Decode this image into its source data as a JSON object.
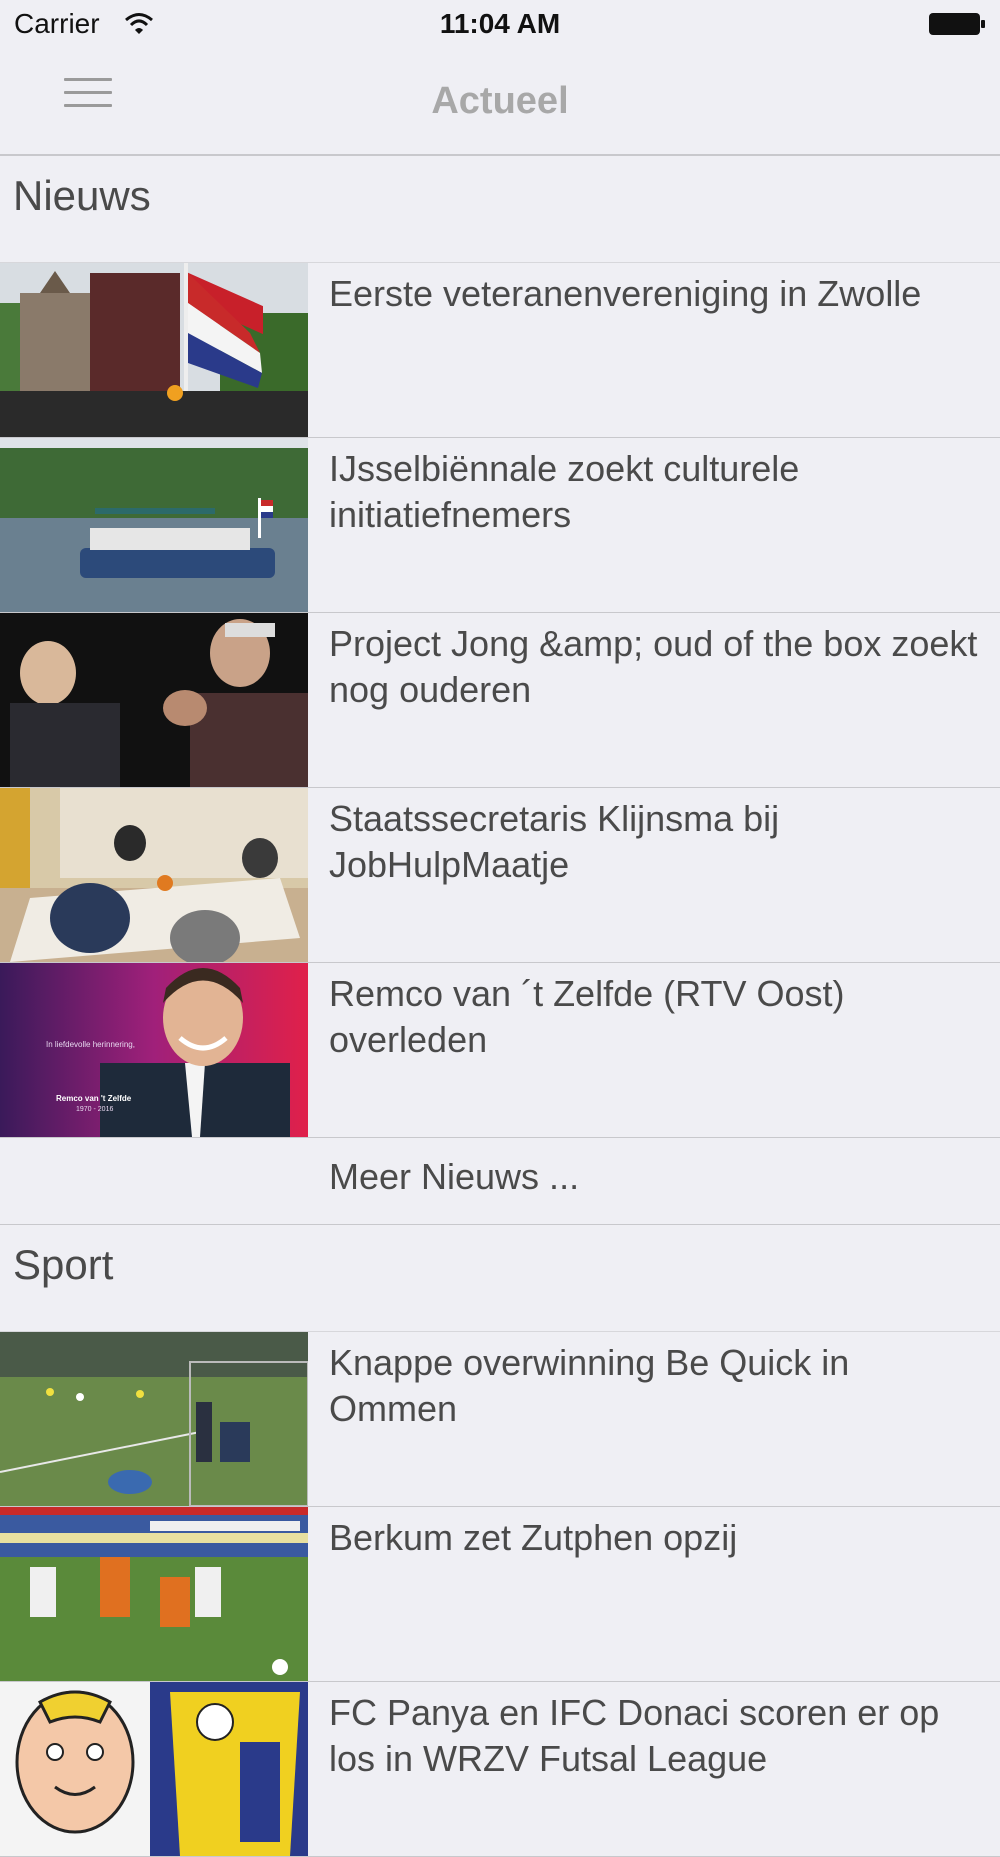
{
  "status_bar": {
    "carrier": "Carrier",
    "time": "11:04 AM"
  },
  "nav": {
    "title": "Actueel",
    "menu_icon": "hamburger-menu-icon"
  },
  "sections": [
    {
      "title": "Nieuws",
      "items": [
        {
          "title": "Eerste veteranenvereniging in Zwolle"
        },
        {
          "title": "IJsselbiënnale zoekt culturele initiatiefnemers"
        },
        {
          "title": "Project Jong &amp; oud of the box zoekt nog ouderen"
        },
        {
          "title": "Staatssecretaris Klijnsma bij JobHulpMaatje"
        },
        {
          "title": "Remco van ´t Zelfde (RTV Oost) overleden",
          "image_text": [
            "In liefdevolle herinnering,",
            "Remco van 't Zelfde",
            "1970 - 2016"
          ]
        }
      ],
      "more_label": "Meer Nieuws ..."
    },
    {
      "title": "Sport",
      "items": [
        {
          "title": "Knappe overwinning Be Quick in Ommen"
        },
        {
          "title": "Berkum zet Zutphen opzij"
        },
        {
          "title": "FC Panya en IFC Donaci scoren er op los in WRZV Futsal League"
        }
      ]
    }
  ]
}
